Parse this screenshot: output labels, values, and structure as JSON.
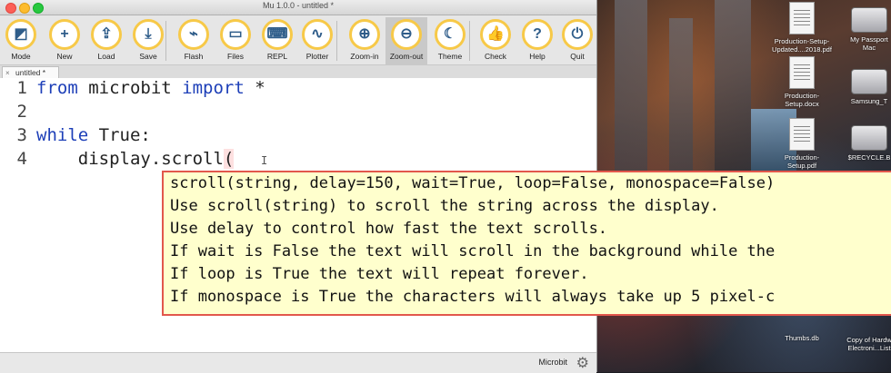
{
  "window": {
    "title": "Mu 1.0.0 - untitled *"
  },
  "toolbar": {
    "buttons": [
      {
        "label": "Mode",
        "glyph": "◩",
        "icon": "mode-icon"
      },
      {
        "label": "New",
        "glyph": "+",
        "icon": "plus-icon"
      },
      {
        "label": "Load",
        "glyph": "⇪",
        "icon": "upload-icon"
      },
      {
        "label": "Save",
        "glyph": "⤓",
        "icon": "download-icon"
      },
      {
        "label": "Flash",
        "glyph": "⌁",
        "icon": "usb-icon"
      },
      {
        "label": "Files",
        "glyph": "▭",
        "icon": "microbit-icon"
      },
      {
        "label": "REPL",
        "glyph": "⌨",
        "icon": "keyboard-icon"
      },
      {
        "label": "Plotter",
        "glyph": "∿",
        "icon": "waveform-icon"
      },
      {
        "label": "Zoom-in",
        "glyph": "⊕",
        "icon": "zoom-in-icon"
      },
      {
        "label": "Zoom-out",
        "glyph": "⊖",
        "icon": "zoom-out-icon"
      },
      {
        "label": "Theme",
        "glyph": "☾",
        "icon": "moon-icon"
      },
      {
        "label": "Check",
        "glyph": "👍",
        "icon": "thumbs-up-icon"
      },
      {
        "label": "Help",
        "glyph": "?",
        "icon": "question-icon"
      },
      {
        "label": "Quit",
        "glyph": "⏻",
        "icon": "power-icon"
      }
    ]
  },
  "tab": {
    "label": "untitled *",
    "close": "×"
  },
  "editor": {
    "line_numbers": [
      "1",
      "2",
      "3",
      "4"
    ],
    "lines": {
      "l1_kw1": "from",
      "l1_mod": " microbit ",
      "l1_kw2": "import",
      "l1_rest": " *",
      "l3_kw": "while",
      "l3_rest": " True:",
      "l4_pre": "    display.scroll",
      "l4_paren": "("
    },
    "cursor": "I"
  },
  "calltip": {
    "lines": [
      "scroll(string, delay=150, wait=True, loop=False, monospace=False)",
      "Use scroll(string) to scroll the string across the display.",
      "Use delay to control how fast the text scrolls.",
      "If wait is False the text will scroll in the background while the",
      "If loop is True the text will repeat forever.",
      "If monospace is True the characters will always take up 5 pixel-c"
    ]
  },
  "statusbar": {
    "mode": "Microbit",
    "gear": "⚙"
  },
  "desktop": {
    "icons": [
      {
        "label1": "Production-Setup-",
        "label2": "Updated....2018.pdf"
      },
      {
        "label1": "My Passport",
        "label2": "Mac"
      },
      {
        "label1": "Production-",
        "label2": "Setup.docx"
      },
      {
        "label1": "Samsung_T",
        "label2": ""
      },
      {
        "label1": "Production-",
        "label2": "Setup.pdf"
      },
      {
        "label1": "$RECYCLE.B",
        "label2": ""
      },
      {
        "label1": "Thumbs.db",
        "label2": ""
      },
      {
        "label1": "Copy of Hardw",
        "label2": "Electroni...List"
      }
    ]
  }
}
